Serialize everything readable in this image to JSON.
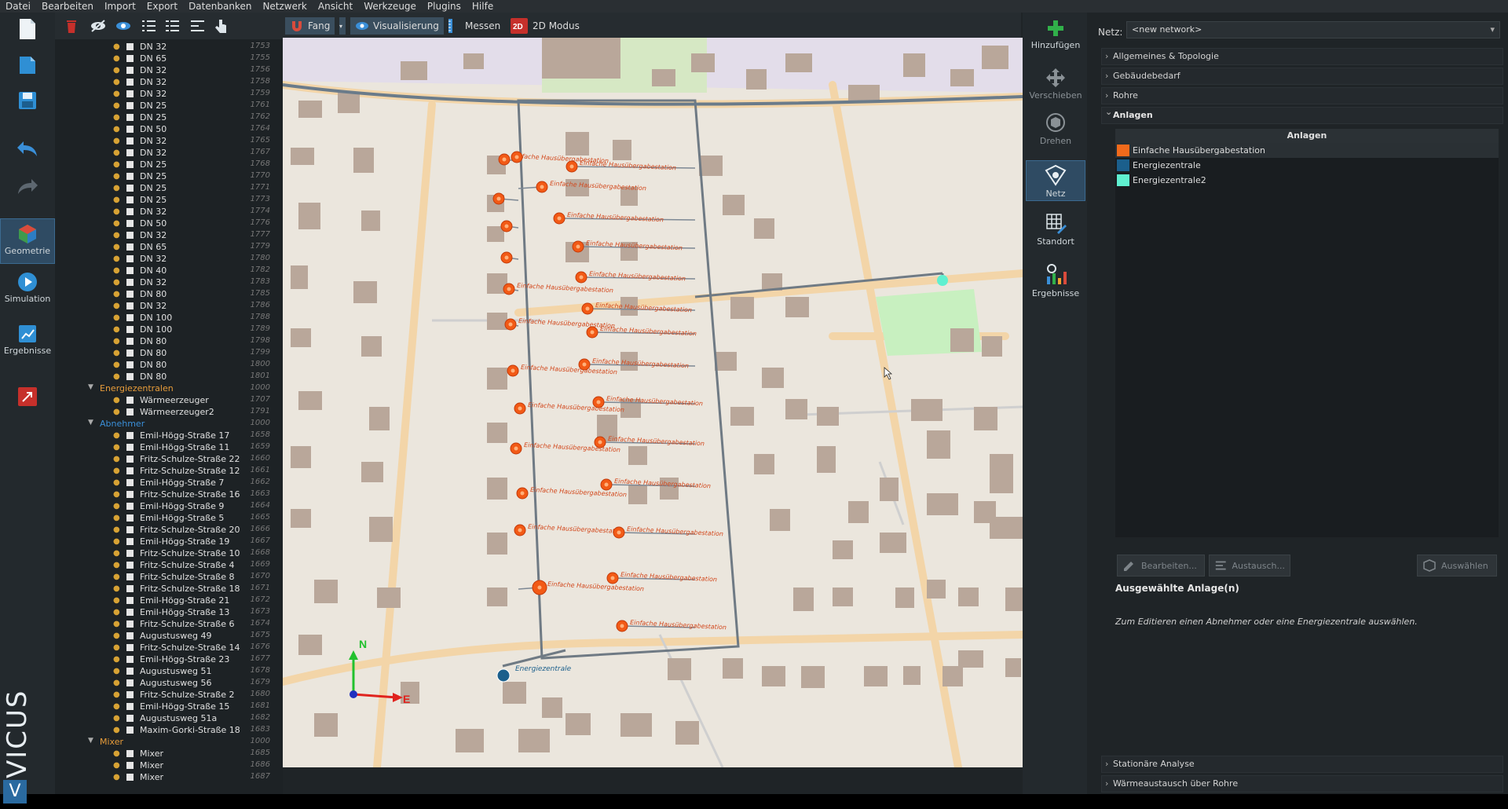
{
  "menu": [
    "Datei",
    "Bearbeiten",
    "Import",
    "Export",
    "Datenbanken",
    "Netzwerk",
    "Ansicht",
    "Werkzeuge",
    "Plugins",
    "Hilfe"
  ],
  "sidebar": {
    "geometry": "Geometrie",
    "simulation": "Simulation",
    "results": "Ergebnisse",
    "brand": "VICUS"
  },
  "tree": {
    "pipes": [
      [
        "DN 32",
        "1753"
      ],
      [
        "DN 65",
        "1755"
      ],
      [
        "DN 32",
        "1756"
      ],
      [
        "DN 32",
        "1758"
      ],
      [
        "DN 32",
        "1759"
      ],
      [
        "DN 25",
        "1761"
      ],
      [
        "DN 25",
        "1762"
      ],
      [
        "DN 50",
        "1764"
      ],
      [
        "DN 32",
        "1765"
      ],
      [
        "DN 32",
        "1767"
      ],
      [
        "DN 25",
        "1768"
      ],
      [
        "DN 25",
        "1770"
      ],
      [
        "DN 25",
        "1771"
      ],
      [
        "DN 25",
        "1773"
      ],
      [
        "DN 32",
        "1774"
      ],
      [
        "DN 50",
        "1776"
      ],
      [
        "DN 32",
        "1777"
      ],
      [
        "DN 65",
        "1779"
      ],
      [
        "DN 32",
        "1780"
      ],
      [
        "DN 40",
        "1782"
      ],
      [
        "DN 32",
        "1783"
      ],
      [
        "DN 80",
        "1785"
      ],
      [
        "DN 32",
        "1786"
      ],
      [
        "DN 100",
        "1788"
      ],
      [
        "DN 100",
        "1789"
      ],
      [
        "DN 80",
        "1798"
      ],
      [
        "DN 80",
        "1799"
      ],
      [
        "DN 80",
        "1800"
      ],
      [
        "DN 80",
        "1801"
      ]
    ],
    "group_energy": {
      "label": "Energiezentralen",
      "id": "1000"
    },
    "energy": [
      [
        "Wärmeerzeuger",
        "1707"
      ],
      [
        "Wärmeerzeuger2",
        "1791"
      ]
    ],
    "group_consumers": {
      "label": "Abnehmer",
      "id": "1000"
    },
    "consumers": [
      [
        "Emil-Högg-Straße 17",
        "1658"
      ],
      [
        "Emil-Högg-Straße 11",
        "1659"
      ],
      [
        "Fritz-Schulze-Straße 22",
        "1660"
      ],
      [
        "Fritz-Schulze-Straße 12",
        "1661"
      ],
      [
        "Emil-Högg-Straße 7",
        "1662"
      ],
      [
        "Fritz-Schulze-Straße 16",
        "1663"
      ],
      [
        "Emil-Högg-Straße 9",
        "1664"
      ],
      [
        "Emil-Högg-Straße 5",
        "1665"
      ],
      [
        "Fritz-Schulze-Straße 20",
        "1666"
      ],
      [
        "Emil-Högg-Straße 19",
        "1667"
      ],
      [
        "Fritz-Schulze-Straße 10",
        "1668"
      ],
      [
        "Fritz-Schulze-Straße 4",
        "1669"
      ],
      [
        "Fritz-Schulze-Straße 8",
        "1670"
      ],
      [
        "Fritz-Schulze-Straße 18",
        "1671"
      ],
      [
        "Emil-Högg-Straße 21",
        "1672"
      ],
      [
        "Emil-Högg-Straße 13",
        "1673"
      ],
      [
        "Fritz-Schulze-Straße 6",
        "1674"
      ],
      [
        "Augustusweg 49",
        "1675"
      ],
      [
        "Fritz-Schulze-Straße 14",
        "1676"
      ],
      [
        "Emil-Högg-Straße 23",
        "1677"
      ],
      [
        "Augustusweg 51",
        "1678"
      ],
      [
        "Augustusweg 56",
        "1679"
      ],
      [
        "Fritz-Schulze-Straße 2",
        "1680"
      ],
      [
        "Emil-Högg-Straße 15",
        "1681"
      ],
      [
        "Augustusweg 51a",
        "1682"
      ],
      [
        "Maxim-Gorki-Straße 18",
        "1683"
      ]
    ],
    "group_mixer": {
      "label": "Mixer",
      "id": "1000"
    },
    "mixers": [
      [
        "Mixer",
        "1685"
      ],
      [
        "Mixer",
        "1686"
      ],
      [
        "Mixer",
        "1687"
      ]
    ]
  },
  "viewtoolbar": {
    "snap": "Fang",
    "visualization": "Visualisierung",
    "measure": "Messen",
    "mode2d": "2D Modus"
  },
  "map": {
    "station_label": "Einfache Hausübergabestation",
    "central_label": "Energiezentrale",
    "north": "N",
    "east": "E"
  },
  "rightbar": {
    "add": "Hinzufügen",
    "move": "Verschieben",
    "rotate": "Drehen",
    "network": "Netz",
    "location": "Standort",
    "results": "Ergebnisse"
  },
  "props": {
    "net_label": "Netz:",
    "net_value": "<new network>",
    "sections": {
      "general": "Allgemeines & Topologie",
      "demand": "Gebäudebedarf",
      "pipes": "Rohre",
      "plants": "Anlagen",
      "stationary": "Stationäre Analyse",
      "heat_exchange": "Wärmeaustausch über Rohre"
    },
    "table_header": "Anlagen",
    "plants": [
      {
        "name": "Einfache Hausübergabestation",
        "color": "#f26a1b"
      },
      {
        "name": "Energiezentrale",
        "color": "#1b5f8c"
      },
      {
        "name": "Energiezentrale2",
        "color": "#5ff0d0"
      }
    ],
    "btn_edit": "Bearbeiten...",
    "btn_replace": "Austausch...",
    "btn_select": "Auswählen",
    "selected_heading": "Ausgewählte Anlage(n)",
    "hint": "Zum Editieren einen Abnehmer oder eine Energiezentrale auswählen."
  }
}
